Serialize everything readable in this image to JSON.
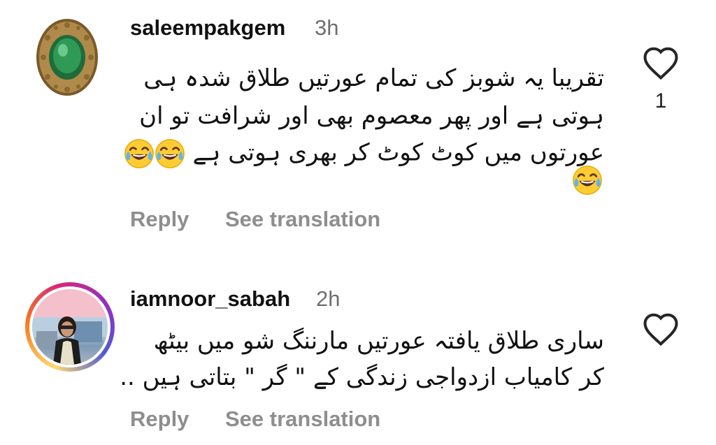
{
  "comments": [
    {
      "username": "saleempakgem",
      "time": "3h",
      "lines": [
        "تقریبا یہ شوبز کی تمام عورتیں طلاق شدہ ہی",
        "ہوتی ہے اور پھر معصوم بھی اور شرافت تو ان",
        "عورتوں میں کوٹ کوٹ کر بھری ہوتی ہے"
      ],
      "emoji": "face-with-tears-of-joy",
      "like_count": "1",
      "reply_label": "Reply",
      "translate_label": "See translation"
    },
    {
      "username": "iamnoor_sabah",
      "time": "2h",
      "lines": [
        "ساری طلاق یافتہ عورتیں مارننگ شو میں بیٹھ",
        "کر کامیاب ازدواجی زندگی کے \" گر \" بتاتی ہیں .."
      ],
      "like_count": "",
      "reply_label": "Reply",
      "translate_label": "See translation"
    }
  ]
}
